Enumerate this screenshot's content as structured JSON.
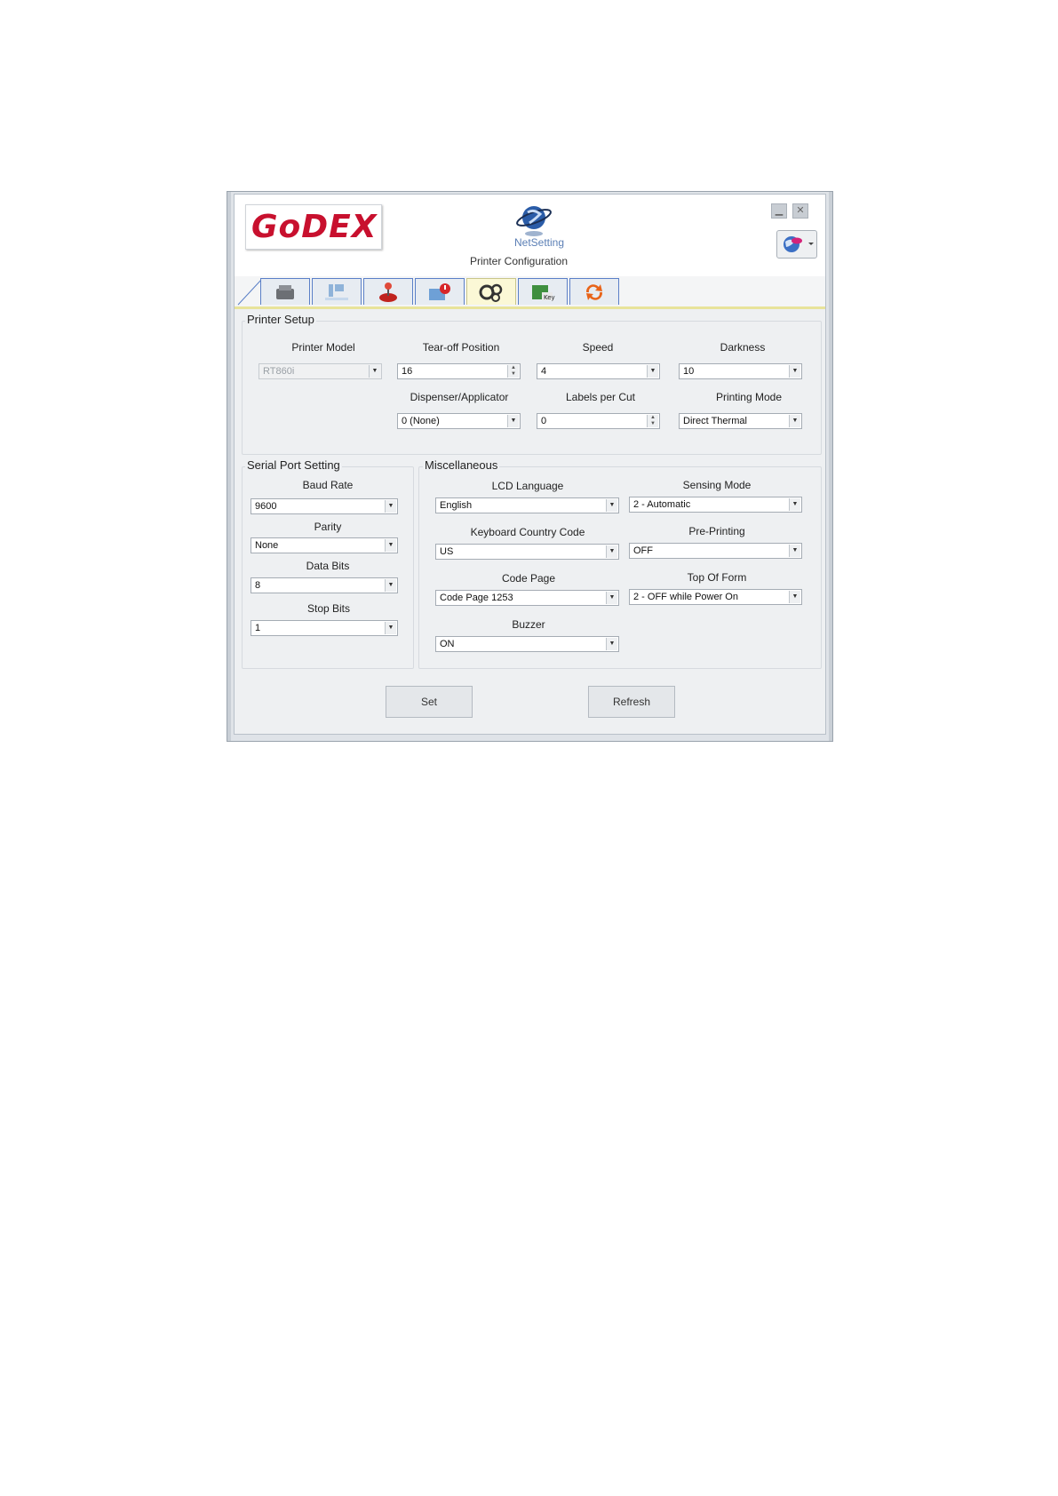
{
  "header": {
    "logo_text": "GoDEX",
    "app_name": "NetSetting",
    "title": "Printer Configuration"
  },
  "tabs": [
    {
      "icon": "printer-icon"
    },
    {
      "icon": "network-ip-icon"
    },
    {
      "icon": "joystick-icon"
    },
    {
      "icon": "alert-mail-icon"
    },
    {
      "icon": "gears-icon",
      "active": true
    },
    {
      "icon": "key-icon"
    },
    {
      "icon": "refresh-icon"
    }
  ],
  "printer_setup": {
    "title": "Printer Setup",
    "printer_model": {
      "label": "Printer Model",
      "value": "RT860i"
    },
    "tearoff": {
      "label": "Tear-off  Position",
      "value": "16"
    },
    "speed": {
      "label": "Speed",
      "value": "4"
    },
    "darkness": {
      "label": "Darkness",
      "value": "10"
    },
    "dispenser": {
      "label": "Dispenser/Applicator",
      "value": "0 (None)"
    },
    "labels_per_cut": {
      "label": "Labels  per Cut",
      "value": "0"
    },
    "printing_mode": {
      "label": "Printing Mode",
      "value": "Direct Thermal"
    }
  },
  "serial": {
    "title": "Serial Port Setting",
    "baud_rate": {
      "label": "Baud Rate",
      "value": "9600"
    },
    "parity": {
      "label": "Parity",
      "value": "None"
    },
    "data_bits": {
      "label": "Data Bits",
      "value": "8"
    },
    "stop_bits": {
      "label": "Stop Bits",
      "value": "1"
    }
  },
  "misc": {
    "title": "Miscellaneous",
    "lcd_language": {
      "label": "LCD Language",
      "value": "English"
    },
    "sensing_mode": {
      "label": "Sensing Mode",
      "value": "2 - Automatic"
    },
    "keyboard_code": {
      "label": "Keyboard Country Code",
      "value": "US"
    },
    "pre_printing": {
      "label": "Pre-Printing",
      "value": "OFF"
    },
    "code_page": {
      "label": "Code Page",
      "value": "Code Page 1253"
    },
    "top_of_form": {
      "label": "Top Of Form",
      "value": "2 - OFF while Power On"
    },
    "buzzer": {
      "label": "Buzzer",
      "value": "ON"
    }
  },
  "buttons": {
    "set": "Set",
    "refresh": "Refresh"
  }
}
